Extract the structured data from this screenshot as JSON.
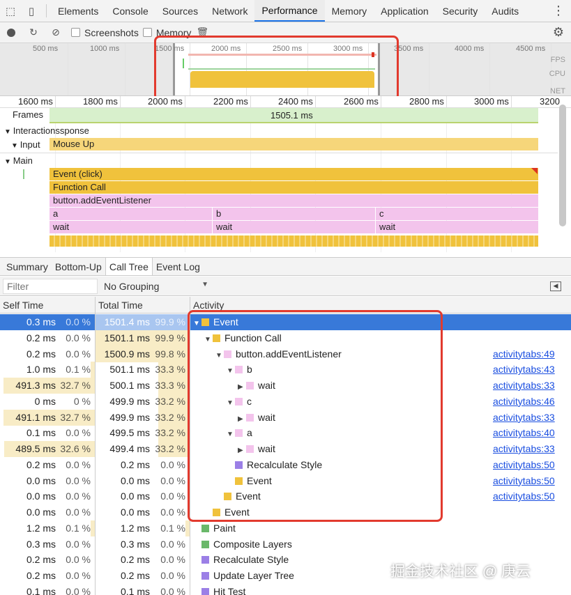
{
  "tabs": [
    "Elements",
    "Console",
    "Sources",
    "Network",
    "Performance",
    "Memory",
    "Application",
    "Security",
    "Audits"
  ],
  "toolbar": {
    "screenshots": "Screenshots",
    "memory": "Memory"
  },
  "overview": {
    "ticks": [
      "500 ms",
      "1000 ms",
      "1500 ms",
      "2000 ms",
      "2500 ms",
      "3000 ms",
      "3500 ms",
      "4000 ms",
      "4500 ms"
    ],
    "labels": [
      "FPS",
      "CPU",
      "NET"
    ]
  },
  "ruler": [
    "1600 ms",
    "1800 ms",
    "2000 ms",
    "2200 ms",
    "2400 ms",
    "2600 ms",
    "2800 ms",
    "3000 ms",
    "3200"
  ],
  "flame": {
    "frames_label": "Frames",
    "frames_value": "1505.1 ms",
    "interactions_label": "Interactions",
    "interactions_suffix": "sponse",
    "input_label": "Input",
    "input_value": "Mouse Up",
    "main_label": "Main",
    "event_click": "Event (click)",
    "function_call": "Function Call",
    "listener": "button.addEventListener",
    "segments": [
      {
        "name": "a",
        "wait": "wait"
      },
      {
        "name": "b",
        "wait": "wait"
      },
      {
        "name": "c",
        "wait": "wait"
      }
    ]
  },
  "bottom_tabs": [
    "Summary",
    "Bottom-Up",
    "Call Tree",
    "Event Log"
  ],
  "filter": {
    "placeholder": "Filter",
    "grouping": "No Grouping"
  },
  "table": {
    "headers": {
      "self": "Self Time",
      "total": "Total Time",
      "activity": "Activity"
    },
    "rows": [
      {
        "self": "0.3 ms",
        "selfp": "0.0 %",
        "total": "1501.4 ms",
        "totalp": "99.9 %",
        "activity": "Event",
        "link": "",
        "indent": 0,
        "tri": "▼",
        "color": "#f0c23c",
        "selfw": 0.0,
        "totalw": 0.999
      },
      {
        "self": "0.2 ms",
        "selfp": "0.0 %",
        "total": "1501.1 ms",
        "totalp": "99.9 %",
        "activity": "Function Call",
        "link": "",
        "indent": 1,
        "tri": "▼",
        "color": "#f0c23c",
        "selfw": 0.0,
        "totalw": 0.999
      },
      {
        "self": "0.2 ms",
        "selfp": "0.0 %",
        "total": "1500.9 ms",
        "totalp": "99.8 %",
        "activity": "button.addEventListener",
        "link": "activitytabs:49",
        "indent": 2,
        "tri": "▼",
        "color": "#f3c4ec",
        "selfw": 0.0,
        "totalw": 0.998
      },
      {
        "self": "1.0 ms",
        "selfp": "0.1 %",
        "total": "501.1 ms",
        "totalp": "33.3 %",
        "activity": "b",
        "link": "activitytabs:43",
        "indent": 3,
        "tri": "▼",
        "color": "#f3c4ec",
        "selfw": 0.001,
        "totalw": 0.333
      },
      {
        "self": "491.3 ms",
        "selfp": "32.7 %",
        "total": "500.1 ms",
        "totalp": "33.3 %",
        "activity": "wait",
        "link": "activitytabs:33",
        "indent": 4,
        "tri": "▶",
        "color": "#f3c4ec",
        "selfw": 0.327,
        "totalw": 0.333
      },
      {
        "self": "0 ms",
        "selfp": "0 %",
        "total": "499.9 ms",
        "totalp": "33.2 %",
        "activity": "c",
        "link": "activitytabs:46",
        "indent": 3,
        "tri": "▼",
        "color": "#f3c4ec",
        "selfw": 0.0,
        "totalw": 0.332
      },
      {
        "self": "491.1 ms",
        "selfp": "32.7 %",
        "total": "499.9 ms",
        "totalp": "33.2 %",
        "activity": "wait",
        "link": "activitytabs:33",
        "indent": 4,
        "tri": "▶",
        "color": "#f3c4ec",
        "selfw": 0.327,
        "totalw": 0.332
      },
      {
        "self": "0.1 ms",
        "selfp": "0.0 %",
        "total": "499.5 ms",
        "totalp": "33.2 %",
        "activity": "a",
        "link": "activitytabs:40",
        "indent": 3,
        "tri": "▼",
        "color": "#f3c4ec",
        "selfw": 0.0,
        "totalw": 0.332
      },
      {
        "self": "489.5 ms",
        "selfp": "32.6 %",
        "total": "499.4 ms",
        "totalp": "33.2 %",
        "activity": "wait",
        "link": "activitytabs:33",
        "indent": 4,
        "tri": "▶",
        "color": "#f3c4ec",
        "selfw": 0.326,
        "totalw": 0.332
      },
      {
        "self": "0.2 ms",
        "selfp": "0.0 %",
        "total": "0.2 ms",
        "totalp": "0.0 %",
        "activity": "Recalculate Style",
        "link": "activitytabs:50",
        "indent": 3,
        "tri": "",
        "color": "#9b7fe6",
        "selfw": 0.0,
        "totalw": 0.0
      },
      {
        "self": "0.0 ms",
        "selfp": "0.0 %",
        "total": "0.0 ms",
        "totalp": "0.0 %",
        "activity": "Event",
        "link": "activitytabs:50",
        "indent": 3,
        "tri": "",
        "color": "#f0c23c",
        "selfw": 0.0,
        "totalw": 0.0
      },
      {
        "self": "0.0 ms",
        "selfp": "0.0 %",
        "total": "0.0 ms",
        "totalp": "0.0 %",
        "activity": "Event",
        "link": "activitytabs:50",
        "indent": 2,
        "tri": "",
        "color": "#f0c23c",
        "selfw": 0.0,
        "totalw": 0.0
      },
      {
        "self": "0.0 ms",
        "selfp": "0.0 %",
        "total": "0.0 ms",
        "totalp": "0.0 %",
        "activity": "Event",
        "link": "",
        "indent": 1,
        "tri": "",
        "color": "#f0c23c",
        "selfw": 0.0,
        "totalw": 0.0
      },
      {
        "self": "1.2 ms",
        "selfp": "0.1 %",
        "total": "1.2 ms",
        "totalp": "0.1 %",
        "activity": "Paint",
        "link": "",
        "indent": 0,
        "tri": "",
        "color": "#6ab86a",
        "selfw": 0.001,
        "totalw": 0.001
      },
      {
        "self": "0.3 ms",
        "selfp": "0.0 %",
        "total": "0.3 ms",
        "totalp": "0.0 %",
        "activity": "Composite Layers",
        "link": "",
        "indent": 0,
        "tri": "",
        "color": "#6ab86a",
        "selfw": 0.0,
        "totalw": 0.0
      },
      {
        "self": "0.2 ms",
        "selfp": "0.0 %",
        "total": "0.2 ms",
        "totalp": "0.0 %",
        "activity": "Recalculate Style",
        "link": "",
        "indent": 0,
        "tri": "",
        "color": "#9b7fe6",
        "selfw": 0.0,
        "totalw": 0.0
      },
      {
        "self": "0.2 ms",
        "selfp": "0.0 %",
        "total": "0.2 ms",
        "totalp": "0.0 %",
        "activity": "Update Layer Tree",
        "link": "",
        "indent": 0,
        "tri": "",
        "color": "#9b7fe6",
        "selfw": 0.0,
        "totalw": 0.0
      },
      {
        "self": "0.1 ms",
        "selfp": "0.0 %",
        "total": "0.1 ms",
        "totalp": "0.0 %",
        "activity": "Hit Test",
        "link": "",
        "indent": 0,
        "tri": "",
        "color": "#9b7fe6",
        "selfw": 0.0,
        "totalw": 0.0
      }
    ]
  },
  "watermark": "掘金技术社区 @ 庚云",
  "colors": {
    "accent": "#1a73e8",
    "selected_row": "#3879d9",
    "highlight": "#e23a2e",
    "event": "#f0c23c",
    "script": "#f3c4ec",
    "rendering": "#9b7fe6",
    "painting": "#6ab86a"
  }
}
